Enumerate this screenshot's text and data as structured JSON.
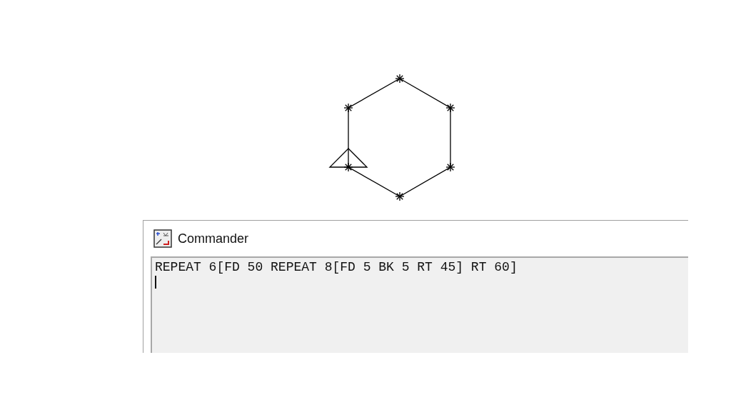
{
  "commander": {
    "title": "Commander",
    "command": "REPEAT 6[FD 50 REPEAT 8[FD 5 BK 5 RT 45] RT 60]"
  }
}
